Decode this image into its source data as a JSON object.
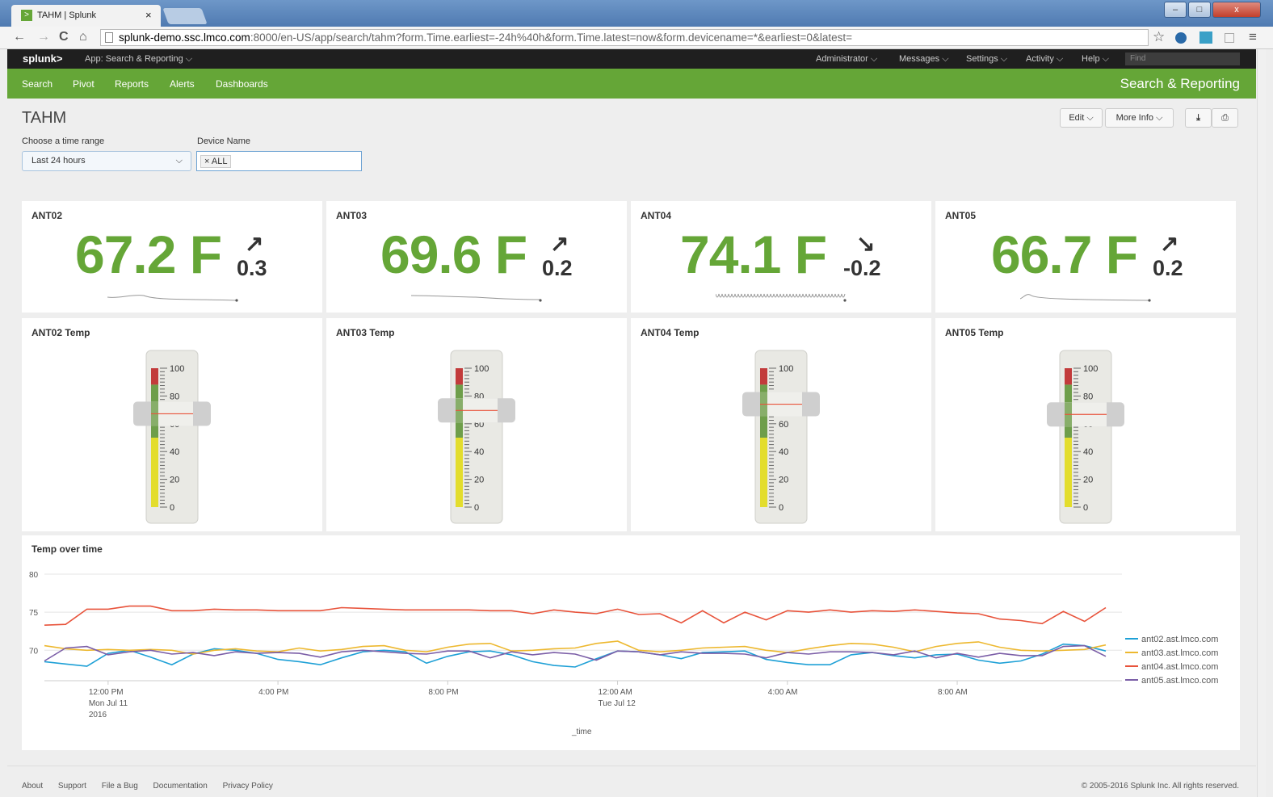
{
  "browser": {
    "tab_title": "TAHM | Splunk",
    "tab_close": "×",
    "url_host": "splunk-demo.ssc.lmco.com",
    "url_rest": ":8000/en-US/app/search/tahm?form.Time.earliest=-24h%40h&form.Time.latest=now&form.devicename=*&earliest=0&latest=",
    "back": "←",
    "forward": "→",
    "reload": "C",
    "home": "⌂",
    "star": "☆",
    "menu": "≡",
    "win_min": "–",
    "win_max": "□",
    "win_close": "x"
  },
  "splunk": {
    "logo": "splunk>",
    "app_label": "App: Search & Reporting ⌵",
    "top_nav": [
      "Administrator ⌵",
      "Messages ⌵",
      "Settings ⌵",
      "Activity ⌵",
      "Help ⌵"
    ],
    "find_placeholder": "Find",
    "green_nav": [
      "Search",
      "Pivot",
      "Reports",
      "Alerts",
      "Dashboards"
    ],
    "app_title": "Search & Reporting"
  },
  "dashboard": {
    "title": "TAHM",
    "edit_label": "Edit ⌵",
    "more_info_label": "More Info ⌵",
    "export_icon": "⤓",
    "print_icon": "⎙",
    "time_label": "Choose a time range",
    "time_value": "Last 24 hours",
    "time_chevron": "⌵",
    "device_label": "Device Name",
    "device_token": "× ALL"
  },
  "singles": [
    {
      "title": "ANT02",
      "value": "67.2 F",
      "arrow": "↗",
      "delta": "0.3",
      "trend": "up"
    },
    {
      "title": "ANT03",
      "value": "69.6 F",
      "arrow": "↗",
      "delta": "0.2",
      "trend": "up"
    },
    {
      "title": "ANT04",
      "value": "74.1 F",
      "arrow": "↘",
      "delta": "-0.2",
      "trend": "down"
    },
    {
      "title": "ANT05",
      "value": "66.7 F",
      "arrow": "↗",
      "delta": "0.2",
      "trend": "up"
    }
  ],
  "gauges": [
    {
      "title": "ANT02 Temp",
      "value": 67.2
    },
    {
      "title": "ANT03 Temp",
      "value": 69.6
    },
    {
      "title": "ANT04 Temp",
      "value": 74.1
    },
    {
      "title": "ANT05 Temp",
      "value": 66.7
    }
  ],
  "gauge_ticks": [
    "100",
    "80",
    "60",
    "40",
    "20",
    "0"
  ],
  "gauge_colors": {
    "red": "#c23b3b",
    "green": "#6e9e4a",
    "yellow": "#e3dd2d"
  },
  "chart_data": {
    "type": "line",
    "title": "Temp over time",
    "xlabel": "_time",
    "ylabel": "",
    "ylim": [
      66,
      80
    ],
    "y_ticks": [
      "80",
      "75",
      "70"
    ],
    "x_ticks": [
      {
        "label": [
          "12:00 PM",
          "Mon Jul 11",
          "2016"
        ],
        "index": 3
      },
      {
        "label": [
          "4:00 PM"
        ],
        "index": 11
      },
      {
        "label": [
          "8:00 PM"
        ],
        "index": 19
      },
      {
        "label": [
          "12:00 AM",
          "Tue Jul 12"
        ],
        "index": 27
      },
      {
        "label": [
          "4:00 AM"
        ],
        "index": 35
      },
      {
        "label": [
          "8:00 AM"
        ],
        "index": 43
      }
    ],
    "n_points": 50,
    "series": [
      {
        "name": "ant02.ast.lmco.com",
        "color": "#1ea0d6",
        "values": [
          68.5,
          68.2,
          67.9,
          69.6,
          70.0,
          69.1,
          68.1,
          69.5,
          70.2,
          70.0,
          69.6,
          68.8,
          68.5,
          68.1,
          69.0,
          69.8,
          70.0,
          69.8,
          68.3,
          69.2,
          69.8,
          69.9,
          69.4,
          68.5,
          68.0,
          67.8,
          68.9,
          69.9,
          69.8,
          69.4,
          68.9,
          69.7,
          69.8,
          69.9,
          68.8,
          68.4,
          68.1,
          68.1,
          69.4,
          69.7,
          69.3,
          69.0,
          69.4,
          69.5,
          68.7,
          68.3,
          68.6,
          69.5,
          70.8,
          70.6,
          69.9
        ]
      },
      {
        "name": "ant03.ast.lmco.com",
        "color": "#edb82f",
        "values": [
          70.6,
          70.2,
          70.0,
          70.1,
          70.0,
          70.1,
          70.0,
          69.5,
          70.0,
          70.2,
          69.9,
          69.8,
          70.3,
          69.9,
          70.1,
          70.5,
          70.6,
          70.0,
          69.8,
          70.4,
          70.8,
          70.9,
          69.9,
          70.0,
          70.2,
          70.3,
          70.9,
          71.2,
          70.0,
          69.8,
          70.0,
          70.3,
          70.4,
          70.5,
          70.0,
          69.7,
          70.2,
          70.6,
          70.9,
          70.8,
          70.4,
          69.8,
          70.5,
          70.9,
          71.1,
          70.4,
          70.0,
          69.9,
          70.0,
          70.1,
          70.7
        ]
      },
      {
        "name": "ant04.ast.lmco.com",
        "color": "#e8533b",
        "values": [
          73.3,
          73.4,
          75.4,
          75.4,
          75.8,
          75.8,
          75.2,
          75.2,
          75.4,
          75.3,
          75.3,
          75.2,
          75.2,
          75.2,
          75.6,
          75.5,
          75.4,
          75.3,
          75.3,
          75.3,
          75.3,
          75.2,
          75.2,
          74.8,
          75.3,
          75.0,
          74.8,
          75.4,
          74.7,
          74.8,
          73.6,
          75.2,
          73.6,
          75.0,
          74.0,
          75.2,
          75.0,
          75.3,
          75.0,
          75.2,
          75.1,
          75.3,
          75.1,
          74.9,
          74.8,
          74.1,
          73.9,
          73.5,
          75.1,
          73.8,
          75.6,
          73.9
        ]
      },
      {
        "name": "ant05.ast.lmco.com",
        "color": "#7b5ea7",
        "values": [
          68.6,
          70.3,
          70.5,
          69.4,
          69.8,
          70.0,
          69.5,
          69.7,
          69.3,
          69.8,
          69.6,
          69.7,
          69.6,
          69.1,
          69.8,
          70.0,
          69.8,
          69.6,
          69.5,
          69.9,
          69.9,
          69.0,
          69.8,
          69.4,
          69.7,
          69.5,
          68.7,
          69.9,
          69.8,
          69.4,
          69.8,
          69.6,
          69.6,
          69.5,
          69.0,
          69.7,
          69.5,
          69.8,
          69.8,
          69.7,
          69.4,
          69.9,
          69.0,
          69.6,
          69.1,
          69.6,
          69.3,
          69.3,
          70.5,
          70.6,
          69.2,
          70.1,
          69.8
        ]
      }
    ],
    "legend": "right"
  },
  "footer": {
    "links": [
      "About",
      "Support",
      "File a Bug",
      "Documentation",
      "Privacy Policy"
    ],
    "copyright": "© 2005-2016 Splunk Inc. All rights reserved."
  }
}
